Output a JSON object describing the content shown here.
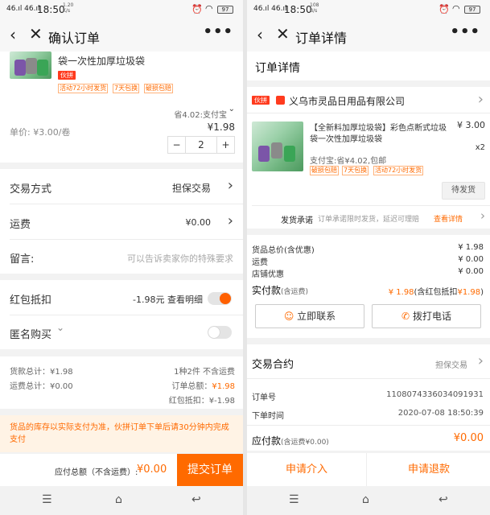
{
  "status": {
    "signal": "46.ıl 46.ıl",
    "time": "18:50",
    "left_speed": "1.20\nK/s",
    "right_speed": "108\nB/s",
    "battery": "97"
  },
  "left": {
    "nav_title": "确认订单",
    "product_title": "袋一次性加厚垃圾袋",
    "badge": "伙拼",
    "tags": [
      "活动72小时发货",
      "7天包换",
      "破损包赔"
    ],
    "saving": "省4.02:支付宝",
    "price": "¥1.98",
    "unit_price": "单价: ¥3.00/卷",
    "qty_minus": "−",
    "qty": "2",
    "qty_plus": "+",
    "trade_label": "交易方式",
    "trade_value": "担保交易",
    "freight_label": "运费",
    "freight_value": "¥0.00",
    "message_label": "留言:",
    "message_placeholder": "可以告诉卖家你的特殊要求",
    "redpack_label": "红包抵扣",
    "redpack_value": "-1.98元  查看明细",
    "anon_label": "匿名购买",
    "sum_goods_label": "货款总计：¥1.98",
    "sum_freight_label": "运费总计：¥0.00",
    "sum_count": "1种2件  不含运费",
    "sum_order_label": "订单总额：",
    "sum_order_value": "¥1.98",
    "sum_redpack": "红包抵扣：¥-1.98",
    "notice": "货品的库存以实际支付为准，伙拼订单下单后请30分钟内完成支付",
    "footer_label": "应付总额（不含运费）:",
    "footer_value": "¥0.00",
    "submit": "提交订单"
  },
  "right": {
    "nav_title": "订单详情",
    "page_title": "订单详情",
    "badge": "伙拼",
    "shop_name": "义乌市灵品日用品有限公司",
    "product_title_1": "【全新料加厚垃圾袋】彩色点断式垃圾",
    "product_title_2": "袋一次性加厚垃圾袋",
    "product_price": "¥ 3.00",
    "product_qty": "x2",
    "pay_saving": "支付宝:省¥4.02,包邮",
    "tags": [
      "破损包赔",
      "7天包换",
      "活动72小时发货"
    ],
    "ship_status": "待发货",
    "promise_label": "发货承诺",
    "promise_text": "订单承诺限时发货，延迟可理赔",
    "promise_link": "查看详情",
    "rows": [
      {
        "label": "货品总价(含优惠)",
        "value": "¥ 1.98"
      },
      {
        "label": "运费",
        "value": "¥ 0.00"
      },
      {
        "label": "店铺优惠",
        "value": "¥ 0.00"
      }
    ],
    "actual_label": "实付款",
    "actual_sub": "(含运费)",
    "actual_value": "¥ 1.98",
    "actual_note": "(含红包抵扣",
    "actual_note_value": "¥1.98",
    "actual_note_end": ")",
    "contact_btn": "立即联系",
    "call_btn": "拨打电话",
    "contract_label": "交易合约",
    "contract_value": "担保交易",
    "order_no_label": "订单号",
    "order_no": "1108074336034091931",
    "order_time_label": "下单时间",
    "order_time": "2020-07-08 18:50:39",
    "payable_label": "应付款",
    "payable_sub": "(含运费¥0.00)",
    "payable_value": "¥0.00",
    "intervene_btn": "申请介入",
    "refund_btn": "申请退款"
  },
  "colors": {
    "accent": "#ff6a00",
    "badge_red": "#ff3b1e"
  }
}
